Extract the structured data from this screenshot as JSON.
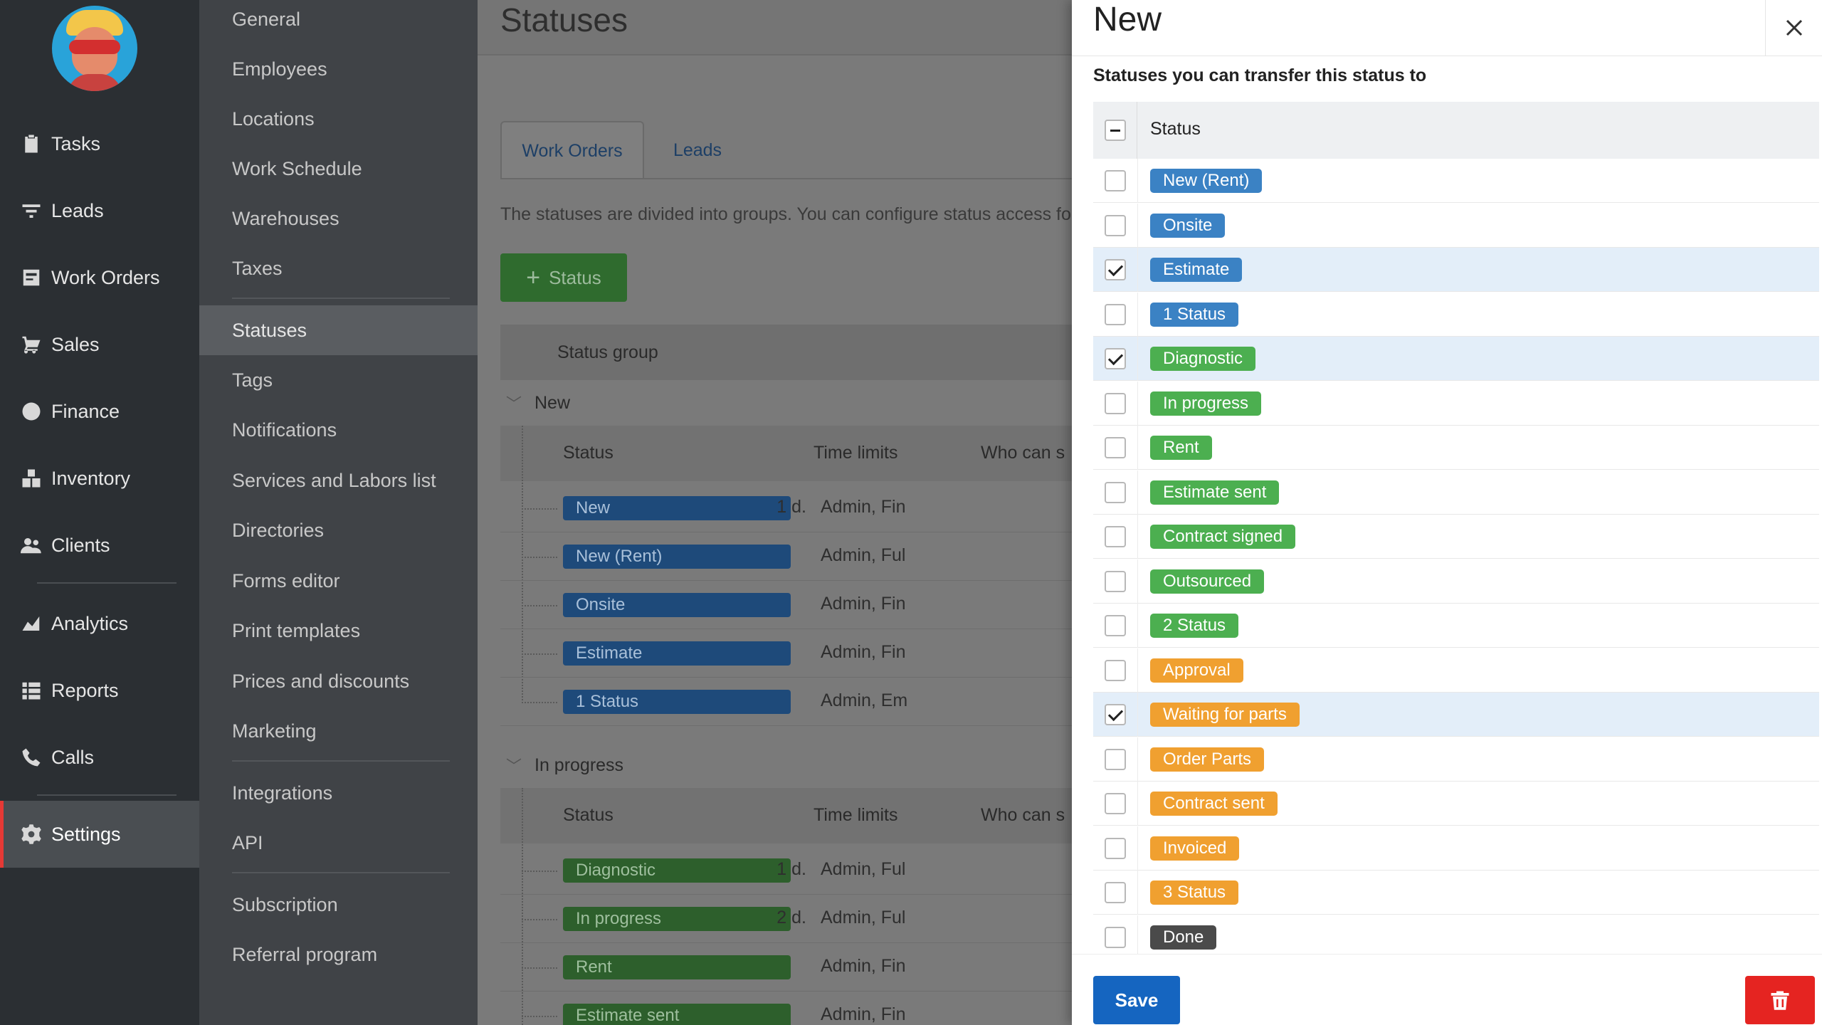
{
  "colors": {
    "blue": "#3b82c4",
    "green": "#4caf50",
    "orange": "#f0a030",
    "dark": "#4a4a4a",
    "primary_button": "#1565c0",
    "danger_button": "#e52421",
    "nav_active_accent": "#e53935"
  },
  "nav": {
    "items": [
      {
        "label": "Tasks",
        "icon": "clipboard-icon"
      },
      {
        "label": "Leads",
        "icon": "funnel-icon"
      },
      {
        "label": "Work Orders",
        "icon": "work-order-icon"
      },
      {
        "label": "Sales",
        "icon": "cart-icon"
      },
      {
        "label": "Finance",
        "icon": "dollar-icon"
      },
      {
        "label": "Inventory",
        "icon": "boxes-icon"
      },
      {
        "label": "Clients",
        "icon": "users-icon"
      },
      {
        "label": "Analytics",
        "icon": "chart-icon"
      },
      {
        "label": "Reports",
        "icon": "list-icon"
      },
      {
        "label": "Calls",
        "icon": "phone-icon"
      },
      {
        "label": "Settings",
        "icon": "gear-icon"
      }
    ]
  },
  "submenu": {
    "items": [
      "General",
      "Employees",
      "Locations",
      "Work Schedule",
      "Warehouses",
      "Taxes",
      "Statuses",
      "Tags",
      "Notifications",
      "Services and Labors list",
      "Directories",
      "Forms editor",
      "Print templates",
      "Prices and discounts",
      "Marketing",
      "Integrations",
      "API",
      "Subscription",
      "Referral program"
    ]
  },
  "main": {
    "title": "Statuses",
    "tabs": [
      "Work Orders",
      "Leads"
    ],
    "description": "The statuses are divided into groups. You can configure status access for",
    "add_button": "Status",
    "table_header": "Status group",
    "sub_columns": {
      "status": "Status",
      "time_limits": "Time limits",
      "who": "Who can s"
    },
    "groups": [
      {
        "name": "New",
        "rows": [
          {
            "status": "New",
            "limit": "1 d.",
            "who": "Admin, Fin"
          },
          {
            "status": "New (Rent)",
            "limit": "",
            "who": "Admin, Ful"
          },
          {
            "status": "Onsite",
            "limit": "",
            "who": "Admin, Fin"
          },
          {
            "status": "Estimate",
            "limit": "",
            "who": "Admin, Fin"
          },
          {
            "status": "1 Status",
            "limit": "",
            "who": "Admin, Em"
          }
        ]
      },
      {
        "name": "In progress",
        "rows": [
          {
            "status": "Diagnostic",
            "limit": "1 d.",
            "who": "Admin, Ful"
          },
          {
            "status": "In progress",
            "limit": "2 d.",
            "who": "Admin, Ful"
          },
          {
            "status": "Rent",
            "limit": "",
            "who": "Admin, Fin"
          },
          {
            "status": "Estimate sent",
            "limit": "",
            "who": "Admin, Fin"
          }
        ]
      }
    ]
  },
  "modal": {
    "title": "New",
    "subtitle": "Statuses you can transfer this status to",
    "list_header": "Status",
    "items": [
      {
        "label": "New (Rent)",
        "color": "blue",
        "checked": false
      },
      {
        "label": "Onsite",
        "color": "blue",
        "checked": false
      },
      {
        "label": "Estimate",
        "color": "blue",
        "checked": true
      },
      {
        "label": "1 Status",
        "color": "blue",
        "checked": false
      },
      {
        "label": "Diagnostic",
        "color": "green",
        "checked": true
      },
      {
        "label": "In progress",
        "color": "green",
        "checked": false
      },
      {
        "label": "Rent",
        "color": "green",
        "checked": false
      },
      {
        "label": "Estimate sent",
        "color": "green",
        "checked": false
      },
      {
        "label": "Contract signed",
        "color": "green",
        "checked": false
      },
      {
        "label": "Outsourced",
        "color": "green",
        "checked": false
      },
      {
        "label": "2 Status",
        "color": "green",
        "checked": false
      },
      {
        "label": "Approval",
        "color": "orange",
        "checked": false
      },
      {
        "label": "Waiting for parts",
        "color": "orange",
        "checked": true
      },
      {
        "label": "Order Parts",
        "color": "orange",
        "checked": false
      },
      {
        "label": "Contract sent",
        "color": "orange",
        "checked": false
      },
      {
        "label": "Invoiced",
        "color": "orange",
        "checked": false
      },
      {
        "label": "3 Status",
        "color": "orange",
        "checked": false
      },
      {
        "label": "Done",
        "color": "dark",
        "checked": false
      }
    ],
    "save_label": "Save"
  }
}
